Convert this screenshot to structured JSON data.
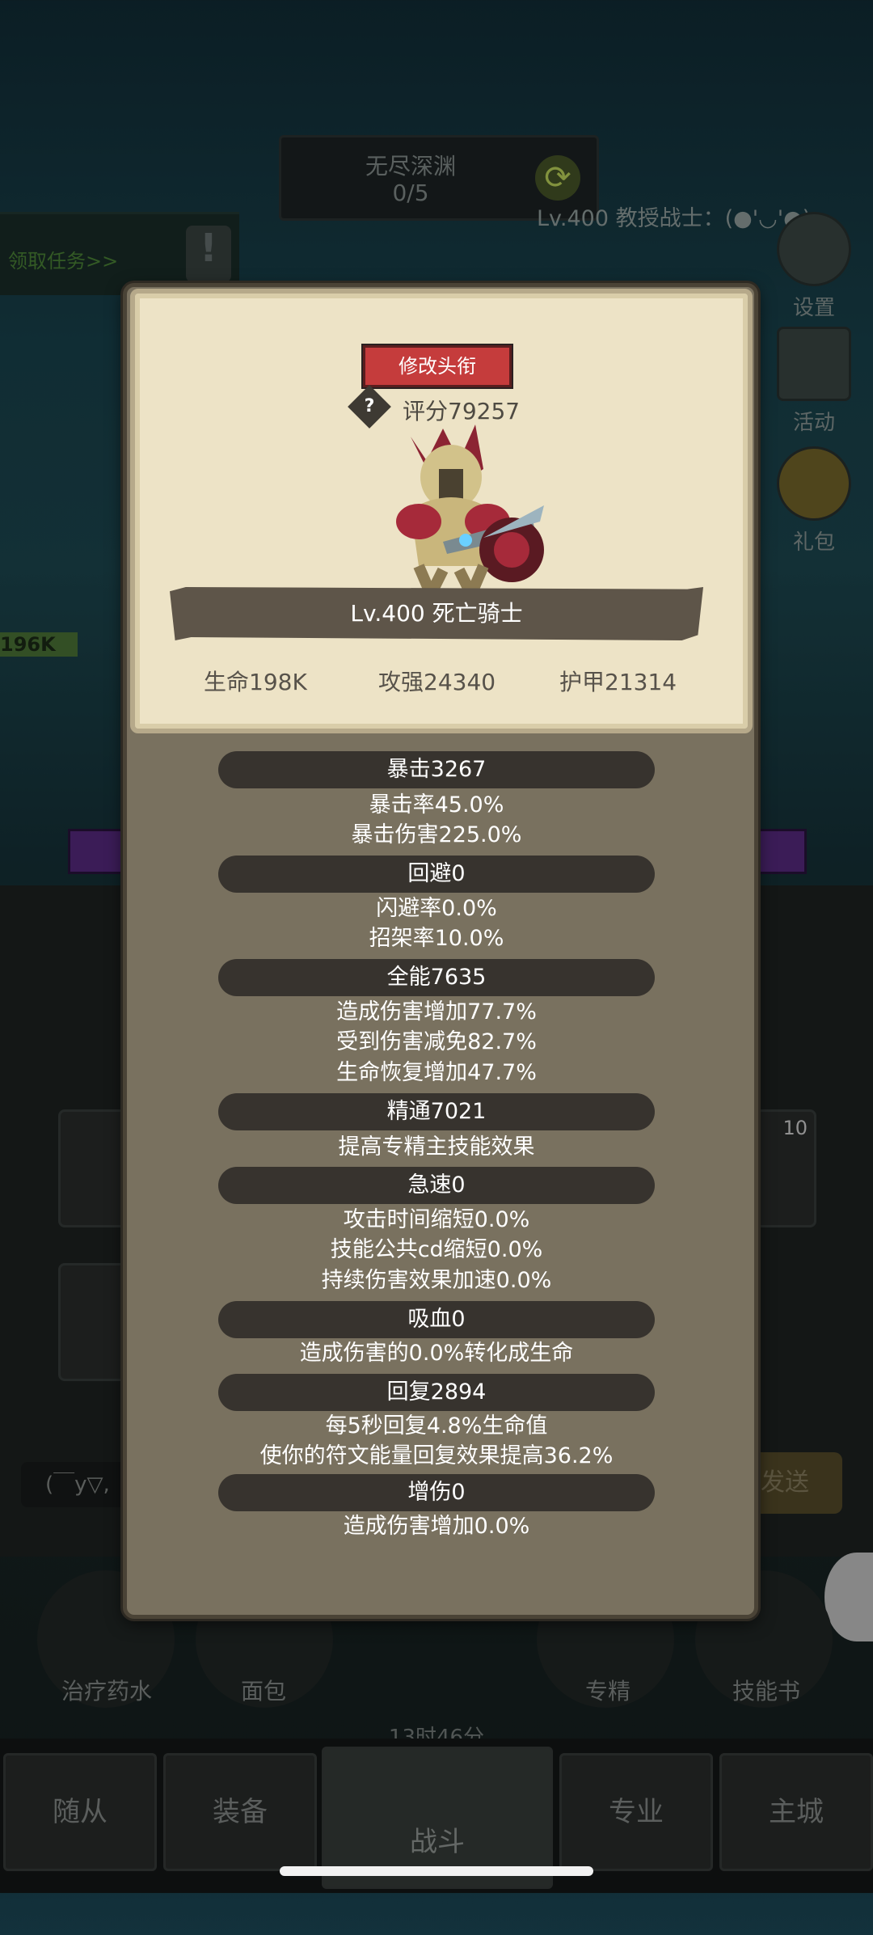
{
  "background": {
    "dungeon_name": "无尽深渊",
    "dungeon_progress": "0/5",
    "player_title": "Lv.400 教授战士：(●'◡'●)",
    "quest_link": "领取任务>>",
    "side_buttons": [
      "设置",
      "活动",
      "礼包"
    ],
    "hp_badge": "196K",
    "chat_text": "(￣y▽,",
    "send_label": "发送",
    "skill_slots": [
      "治疗药水",
      "面包",
      "专精",
      "技能书"
    ],
    "timer": "13时46分",
    "slot_badge": "10",
    "nav_tabs": [
      "随从",
      "装备",
      "战斗",
      "专业",
      "主城"
    ]
  },
  "profile": {
    "edit_title_label": "修改头衔",
    "score_help": "?",
    "score": "评分79257",
    "name": "Lv.400 死亡骑士",
    "stats": [
      "生命198K",
      "攻强24340",
      "护甲21314"
    ]
  },
  "attributes": [
    {
      "header": "暴击3267",
      "lines": [
        "暴击率45.0%",
        "暴击伤害225.0%"
      ]
    },
    {
      "header": "回避0",
      "lines": [
        "闪避率0.0%",
        "招架率10.0%"
      ]
    },
    {
      "header": "全能7635",
      "lines": [
        "造成伤害增加77.7%",
        "受到伤害减免82.7%",
        "生命恢复增加47.7%"
      ]
    },
    {
      "header": "精通7021",
      "lines": [
        "提高专精主技能效果"
      ]
    },
    {
      "header": "急速0",
      "lines": [
        "攻击时间缩短0.0%",
        "技能公共cd缩短0.0%",
        "持续伤害效果加速0.0%"
      ]
    },
    {
      "header": "吸血0",
      "lines": [
        "造成伤害的0.0%转化成生命"
      ]
    },
    {
      "header": "回复2894",
      "lines": [
        "每5秒回复4.8%生命值",
        "使你的符文能量回复效果提高36.2%"
      ]
    },
    {
      "header": "增伤0",
      "lines": [
        "造成伤害增加0.0%"
      ]
    }
  ]
}
